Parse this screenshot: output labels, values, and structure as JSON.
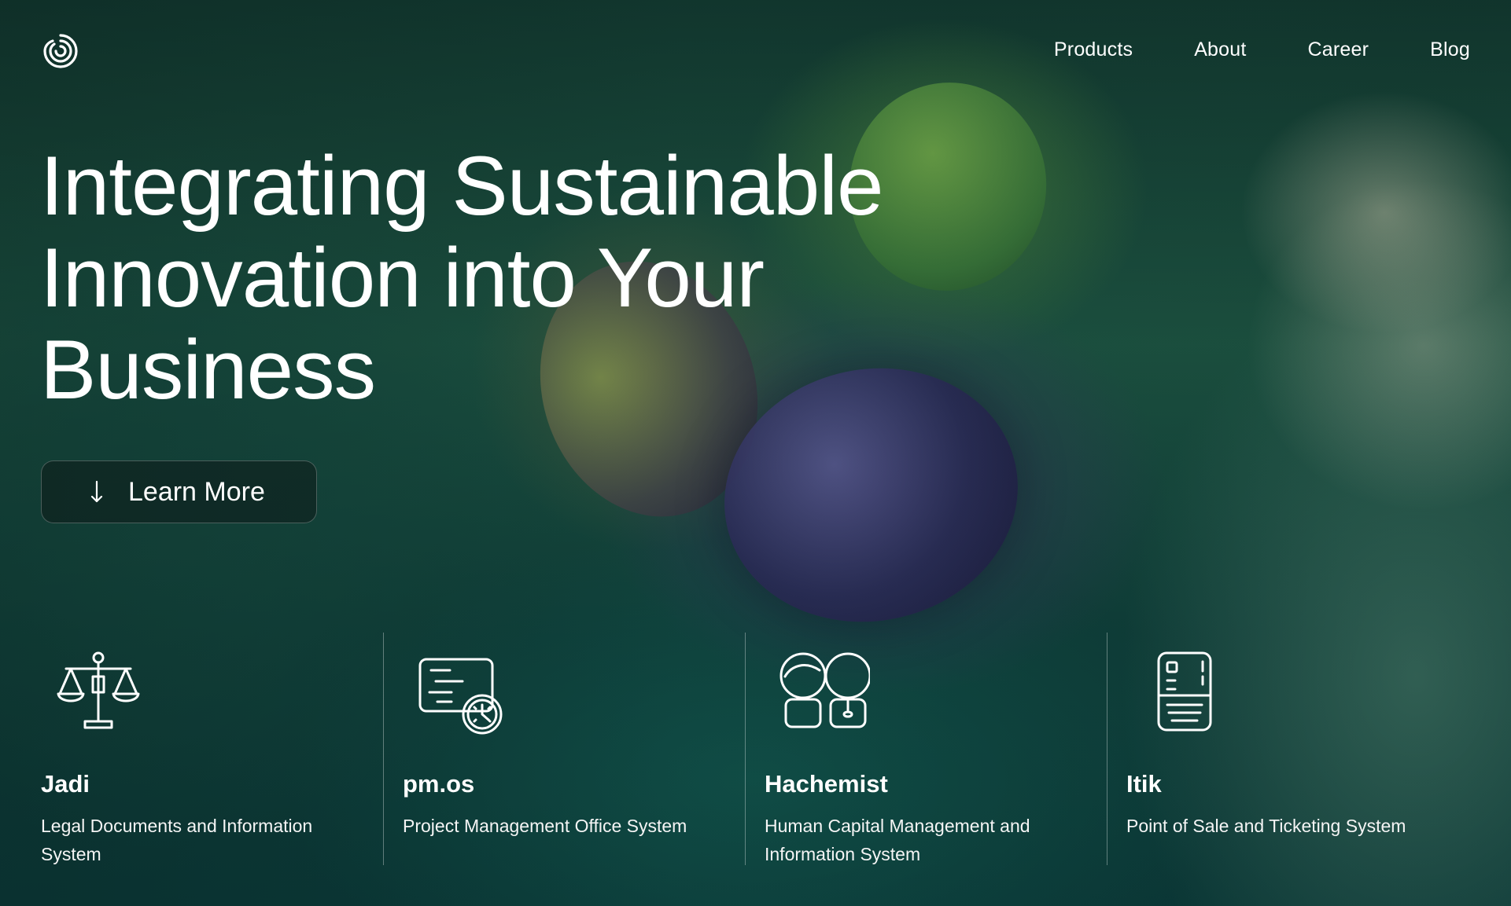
{
  "header": {
    "nav": [
      {
        "label": "Products"
      },
      {
        "label": "About"
      },
      {
        "label": "Career"
      },
      {
        "label": "Blog"
      }
    ]
  },
  "hero": {
    "headline_lines": [
      "Integrating Sustainable",
      "Innovation into Your",
      "Business"
    ],
    "cta_label": "Learn More"
  },
  "products": [
    {
      "title": "Jadi",
      "description": "Legal Documents and Information System",
      "icon": "balance-scale-icon"
    },
    {
      "title": "pm.os",
      "description": "Project Management Office System",
      "icon": "schedule-board-icon"
    },
    {
      "title": "Hachemist",
      "description": "Human Capital Management and Information System",
      "icon": "people-icon"
    },
    {
      "title": "Itik",
      "description": "Point of Sale and Ticketing System",
      "icon": "pos-terminal-icon"
    }
  ],
  "colors": {
    "text": "#ffffff",
    "button_background": "#111818",
    "divider": "#8fb3ab"
  }
}
